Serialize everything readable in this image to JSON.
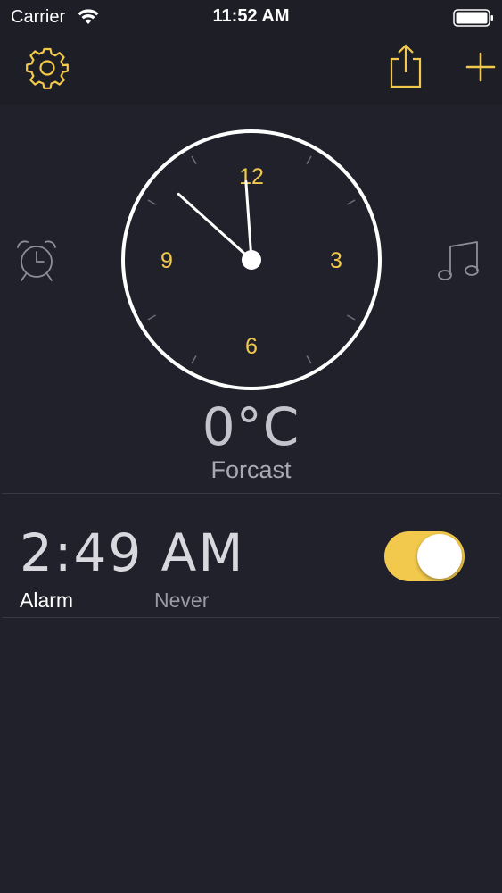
{
  "status_bar": {
    "carrier": "Carrier",
    "time": "11:52 AM",
    "wifi_icon": "wifi-icon",
    "battery_icon": "battery-full-icon"
  },
  "nav": {
    "settings_icon": "gear-icon",
    "share_icon": "share-icon",
    "add_icon": "plus-icon"
  },
  "clock": {
    "hour_labels": [
      "12",
      "3",
      "6",
      "9"
    ],
    "hour": 11,
    "minute": 52,
    "side_left_icon": "alarm-clock-icon",
    "side_right_icon": "music-note-icon"
  },
  "weather": {
    "temperature": "0°C",
    "label": "Forcast"
  },
  "alarm": {
    "time": "2:49 AM",
    "label": "Alarm",
    "repeat": "Never",
    "enabled": true
  },
  "colors": {
    "background": "#21212b",
    "accent": "#f2c94c",
    "text": "#ffffff",
    "muted": "#9a9aa4"
  }
}
